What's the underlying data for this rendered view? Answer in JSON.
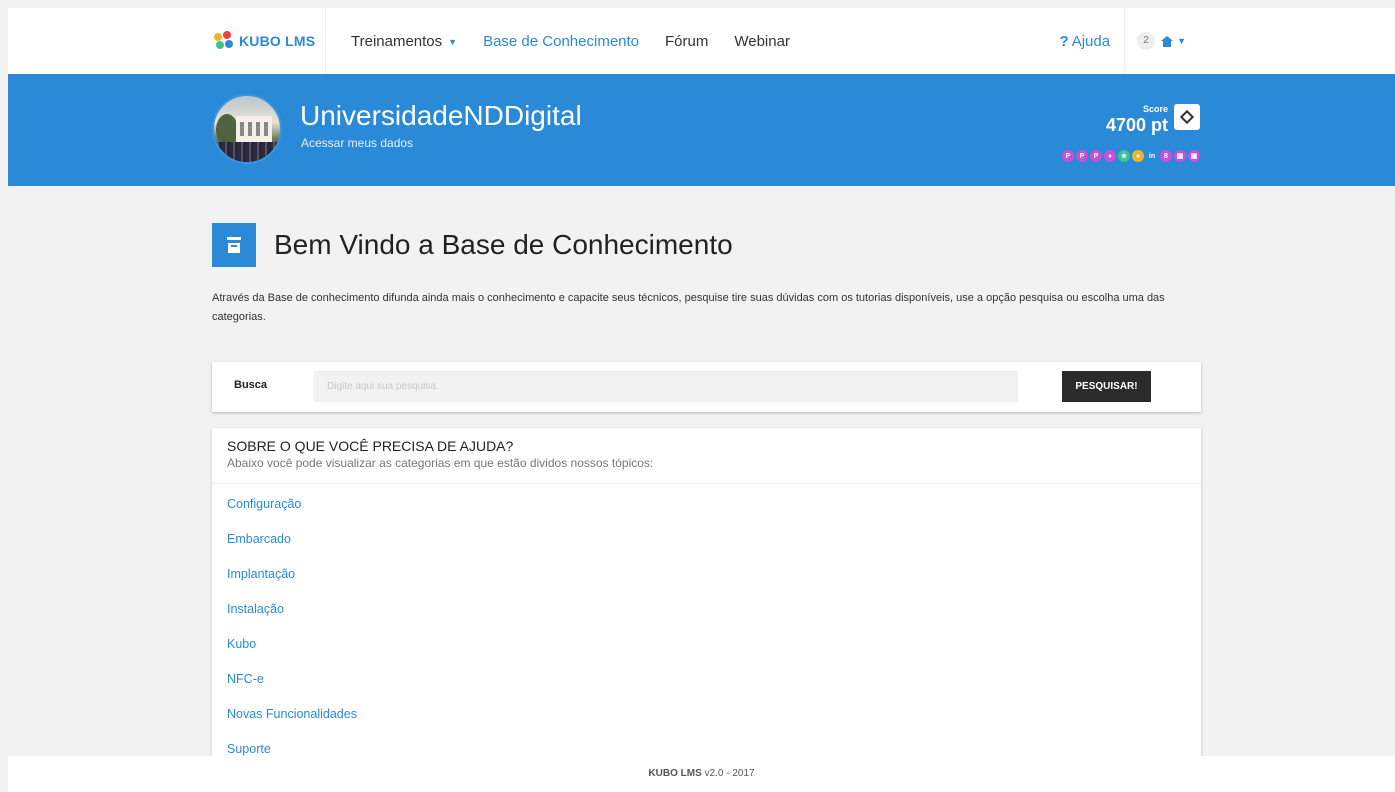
{
  "brand": {
    "name": "KUBO LMS"
  },
  "nav": {
    "items": [
      {
        "label": "Treinamentos",
        "dropdown": true,
        "active": false
      },
      {
        "label": "Base de Conhecimento",
        "dropdown": false,
        "active": true
      },
      {
        "label": "Fórum",
        "dropdown": false,
        "active": false
      },
      {
        "label": "Webinar",
        "dropdown": false,
        "active": false
      }
    ],
    "help_icon": "?",
    "help_label": "Ajuda",
    "notifications_count": "2",
    "home_icon": "home-icon"
  },
  "profile": {
    "name": "UniversidadeNDDigital",
    "link": "Acessar meus dados",
    "score_label": "Score",
    "score_value": "4700 pt",
    "medals": [
      {
        "color": "#c94fd6",
        "icon": "P"
      },
      {
        "color": "#c94fd6",
        "icon": "P"
      },
      {
        "color": "#c94fd6",
        "icon": "P"
      },
      {
        "color": "#c94fd6",
        "icon": "♦"
      },
      {
        "color": "#3ec28f",
        "icon": "★"
      },
      {
        "color": "#f0b429",
        "icon": "●"
      },
      {
        "color": "#2a8ad8",
        "icon": "in"
      },
      {
        "color": "#c94fd6",
        "icon": "8"
      },
      {
        "color": "#c94fd6",
        "icon": "▣"
      },
      {
        "color": "#c94fd6",
        "icon": "▣"
      }
    ]
  },
  "page": {
    "title": "Bem Vindo a Base de Conhecimento",
    "intro": "Através da Base de conhecimento difunda ainda mais o conhecimento e capacite seus técnicos, pesquise tire suas dúvidas com os tutorias disponíveis, use a opção pesquisa ou escolha uma das categorias."
  },
  "search": {
    "label": "Busca",
    "placeholder": "Digite aqui sua pesquisa.",
    "value": "",
    "button_label": "PESQUISAR!"
  },
  "categories": {
    "title": "SOBRE O QUE VOCÊ PRECISA DE AJUDA?",
    "subtitle": "Abaixo você pode visualizar as categorias em que estão dividos nossos tópicos:",
    "items": [
      "Configuração",
      "Embarcado",
      "Implantação",
      "Instalação",
      "Kubo",
      "NFC-e",
      "Novas Funcionalidades",
      "Suporte"
    ]
  },
  "footer": {
    "brand": "KUBO LMS",
    "version": "v2.0 - 2017"
  },
  "colors": {
    "primary": "#2a8ad8",
    "dark_button": "#2b2b2b",
    "background": "#f2f2f2"
  }
}
